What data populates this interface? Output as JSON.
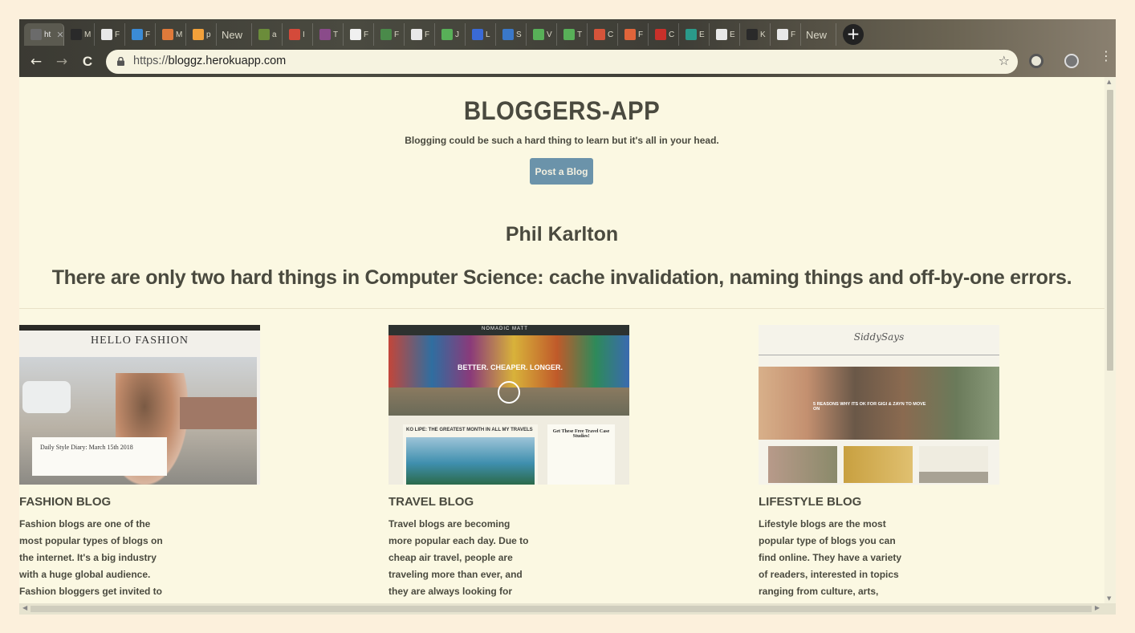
{
  "browser": {
    "tabs": [
      {
        "label": "ht",
        "fav": "#6b6b6b",
        "active": true
      },
      {
        "label": "M",
        "fav": "#2a2a2a"
      },
      {
        "label": "F",
        "fav": "#e8e8e8"
      },
      {
        "label": "F",
        "fav": "#3b8bd6"
      },
      {
        "label": "M",
        "fav": "#e07a3a"
      },
      {
        "label": "p",
        "fav": "#f3a13a"
      },
      {
        "label": "New",
        "fav": null
      },
      {
        "label": "a",
        "fav": "#6b8c3a"
      },
      {
        "label": "I",
        "fav": "#d44a3a"
      },
      {
        "label": "T",
        "fav": "#8a4b8a"
      },
      {
        "label": "F",
        "fav": "#f0f0f0"
      },
      {
        "label": "F",
        "fav": "#4a8a4a"
      },
      {
        "label": "F",
        "fav": "#e8e8e8"
      },
      {
        "label": "J",
        "fav": "#58b058"
      },
      {
        "label": "L",
        "fav": "#3a6ad6"
      },
      {
        "label": "S",
        "fav": "#3a78c8"
      },
      {
        "label": "V",
        "fav": "#58b058"
      },
      {
        "label": "T",
        "fav": "#58b058"
      },
      {
        "label": "C",
        "fav": "#d6543a"
      },
      {
        "label": "F",
        "fav": "#e0643a"
      },
      {
        "label": "C",
        "fav": "#c8302a"
      },
      {
        "label": "E",
        "fav": "#2a9a8a"
      },
      {
        "label": "E",
        "fav": "#e8e8e8"
      },
      {
        "label": "K",
        "fav": "#2a2a2a"
      },
      {
        "label": "F",
        "fav": "#e8e8e8"
      },
      {
        "label": "New",
        "fav": null
      }
    ],
    "new_tab_symbol": "+",
    "back_symbol": "←",
    "forward_symbol": "→",
    "reload_symbol": "C",
    "url_scheme": "https://",
    "url_host": "bloggz.herokuapp.com",
    "bookmark_symbol": "☆",
    "menu_symbol": "⋮"
  },
  "page": {
    "title": "BLOGGERS-APP",
    "subtitle": "Blogging could be such a hard thing to learn but it's all in your head.",
    "post_button": "Post a Blog",
    "quote_author": "Phil Karlton",
    "quote": "There are only two hard things in Computer Science: cache invalidation, naming things and off-by-one errors.",
    "cards": [
      {
        "title": "FASHION BLOG",
        "desc": "Fashion blogs are one of the most popular types of blogs on the internet. It's a big industry with a huge global audience. Fashion bloggers get invited to major",
        "thumb_heading": "HELLO FASHION",
        "thumb_caption": "Daily Style Diary: March 15th 2018"
      },
      {
        "title": "TRAVEL BLOG",
        "desc": "Travel blogs are becoming more popular each day. Due to cheap air travel, people are traveling more than ever, and they are always looking for travel tips, advice, and",
        "thumb_heading": "NOMADIC MATT",
        "thumb_tagline": "BETTER. CHEAPER. LONGER.",
        "thumb_article": "KO LIPE: THE GREATEST MONTH IN ALL MY TRAVELS",
        "thumb_side": "Get These Free Travel Case Studies!"
      },
      {
        "title": "LIFESTYLE BLOG",
        "desc": "Lifestyle blogs are the most popular type of blogs you can find online. They have a variety of readers, interested in topics ranging from culture, arts, local",
        "thumb_heading": "SiddySays",
        "thumb_caption": "5 REASONS WHY ITS OK FOR GIGI & ZAYN TO MOVE ON"
      }
    ]
  }
}
